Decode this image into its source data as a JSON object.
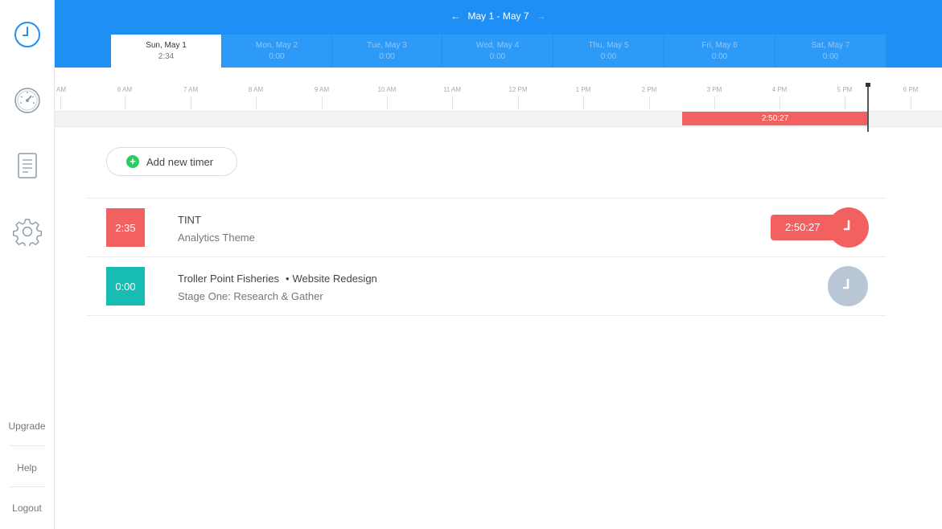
{
  "sidebar": {
    "upgrade": "Upgrade",
    "help": "Help",
    "logout": "Logout"
  },
  "header": {
    "week_range": "May 1 - May 7",
    "days": [
      {
        "name": "Sun, May 1",
        "time": "2:34",
        "active": true
      },
      {
        "name": "Mon, May 2",
        "time": "0:00"
      },
      {
        "name": "Tue, May 3",
        "time": "0:00"
      },
      {
        "name": "Wed, May 4",
        "time": "0:00"
      },
      {
        "name": "Thu, May 5",
        "time": "0:00"
      },
      {
        "name": "Fri, May 6",
        "time": "0:00"
      },
      {
        "name": "Sat, May 7",
        "time": "0:00"
      }
    ]
  },
  "timeline": {
    "hours": [
      "AM",
      "6 AM",
      "7 AM",
      "8 AM",
      "9 AM",
      "10 AM",
      "11 AM",
      "12 PM",
      "1 PM",
      "2 PM",
      "3 PM",
      "4 PM",
      "5 PM",
      "6 PM"
    ],
    "running_bar": "2:50:27"
  },
  "main": {
    "add_timer": "Add new timer",
    "entries": [
      {
        "badge": "2:35",
        "title": "TINT",
        "subtitle": "Analytics Theme",
        "running": "2:50:27",
        "color": "#f2605f"
      },
      {
        "badge": "0:00",
        "client": "Troller Point Fisheries",
        "project": "Website Redesign",
        "subtitle": "Stage One: Research & Gather",
        "color": "#17bdb2"
      }
    ]
  },
  "colors": {
    "header": "#1e8ff5",
    "accent_red": "#f2605f",
    "teal": "#17bdb2",
    "add_green": "#2ecc5f"
  }
}
